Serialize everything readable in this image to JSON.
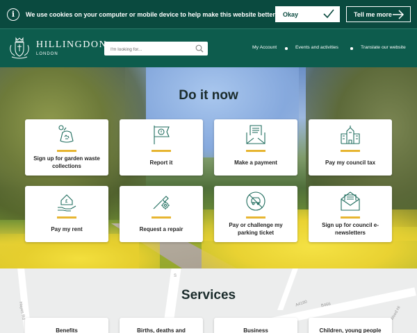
{
  "cookie": {
    "message": "We use cookies on your computer or mobile device to help make this website better.",
    "okay_label": "Okay",
    "more_label": "Tell me more"
  },
  "header": {
    "brand_name": "HILLINGDON",
    "brand_sub": "LONDON",
    "search_placeholder": "I'm looking for...",
    "nav": [
      "My Account",
      "Events and activities",
      "Translate our website"
    ]
  },
  "hero": {
    "title": "Do it now",
    "cards": [
      {
        "label": "Sign up for garden waste collections",
        "icon": "garden-waste-icon"
      },
      {
        "label": "Report it",
        "icon": "report-flag-icon"
      },
      {
        "label": "Make a payment",
        "icon": "payment-envelope-icon"
      },
      {
        "label": "Pay my council tax",
        "icon": "council-house-icon"
      },
      {
        "label": "Pay my rent",
        "icon": "rent-house-hand-icon"
      },
      {
        "label": "Request a repair",
        "icon": "repair-tools-icon"
      },
      {
        "label": "Pay or challenge my parking ticket",
        "icon": "parking-ticket-icon"
      },
      {
        "label": "Sign up for council e-newsletters",
        "icon": "newsletter-icon"
      }
    ]
  },
  "services": {
    "title": "Services",
    "map_labels": [
      "A4180",
      "B466",
      "S",
      "Hayes Rd",
      "Wood Hi"
    ],
    "cards": [
      "Benefits",
      "Births, deaths and",
      "Business",
      "Children, young people"
    ]
  },
  "colors": {
    "cookie_bg": "#0a4a3f",
    "header_bg": "#0d5c4d",
    "accent_bar": "#e7b531",
    "icon_teal": "#1d6b5c"
  }
}
